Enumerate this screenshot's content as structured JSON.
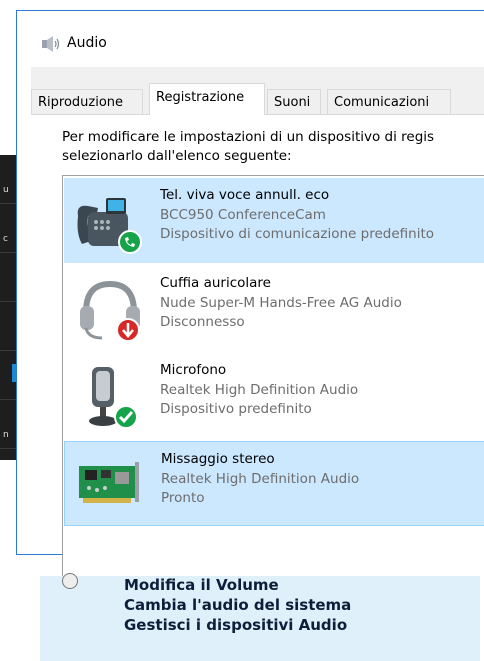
{
  "window": {
    "title": "Audio",
    "icon": "speaker-icon"
  },
  "tabs": [
    {
      "label": "Riproduzione",
      "active": false
    },
    {
      "label": "Registrazione",
      "active": true
    },
    {
      "label": "Suoni",
      "active": false
    },
    {
      "label": "Comunicazioni",
      "active": false
    }
  ],
  "instructions": "Per modificare le impostazioni di un dispositivo di regis selezionarlo dall'elenco seguente:",
  "devices": [
    {
      "name": "Tel. viva voce annull. eco",
      "description": "BCC950 ConferenceCam",
      "status": "Dispositivo di comunicazione predefinito",
      "icon": "speakerphone-icon",
      "badge": "phone-badge-icon"
    },
    {
      "name": "Cuffia auricolare",
      "description": "Nude Super-M Hands-Free AG Audio",
      "status": "Disconnesso",
      "icon": "headset-icon",
      "badge": "disconnected-badge-icon"
    },
    {
      "name": "Microfono",
      "description": "Realtek High Definition Audio",
      "status": "Dispositivo predefinito",
      "icon": "microphone-icon",
      "badge": "default-check-badge-icon"
    },
    {
      "name": "Missaggio stereo",
      "description": "Realtek High Definition Audio",
      "status": "Pronto",
      "icon": "sound-card-icon",
      "badge": ""
    }
  ],
  "caption": {
    "lines": [
      "Modifica il Volume",
      "Cambia l'audio del sistema",
      "Gestisci i dispositivi Audio"
    ]
  },
  "colors": {
    "accent": "#2a7ad6",
    "selection": "#cce8ff",
    "arrow": "#1e88d4",
    "caption_bg": "#dff0fb"
  }
}
